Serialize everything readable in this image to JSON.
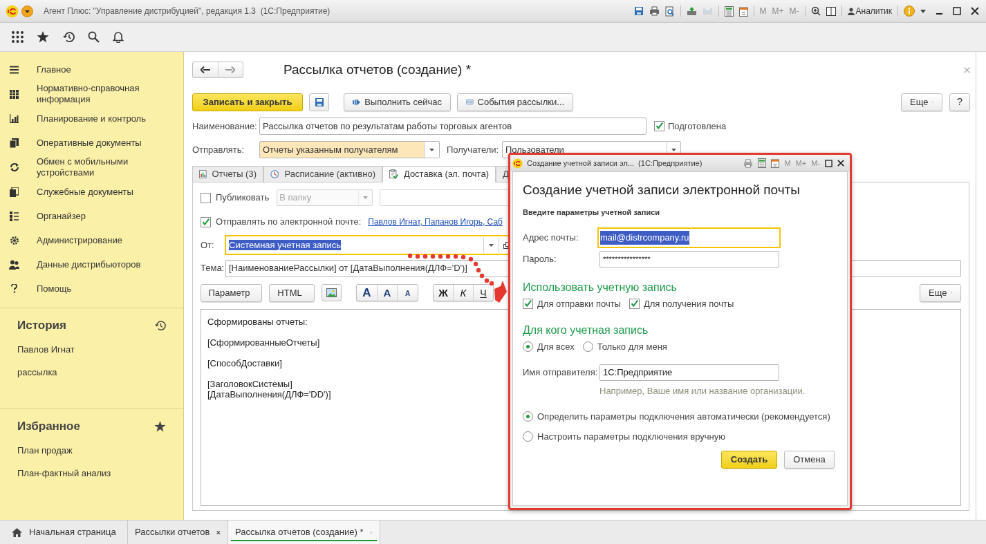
{
  "window": {
    "title": "Агент Плюс: \"Управление дистрибуцией\", редакция 1.3  (1С:Предприятие)",
    "memory_buttons": [
      "M",
      "M+",
      "M-"
    ],
    "user": "Аналитик"
  },
  "sidebar": {
    "items": [
      {
        "label": "Главное"
      },
      {
        "label": "Нормативно-справочная информация"
      },
      {
        "label": "Планирование и контроль"
      },
      {
        "label": "Оперативные документы"
      },
      {
        "label": "Обмен с мобильными устройствами"
      },
      {
        "label": "Служебные документы"
      },
      {
        "label": "Органайзер"
      },
      {
        "label": "Администрирование"
      },
      {
        "label": "Данные дистрибьюторов"
      },
      {
        "label": "Помощь"
      }
    ],
    "history": {
      "title": "История",
      "items": [
        {
          "label": "Павлов Игнат"
        },
        {
          "label": "рассылка"
        }
      ]
    },
    "favorites": {
      "title": "Избранное",
      "items": [
        {
          "label": "План продаж"
        },
        {
          "label": "План-фактный анализ"
        }
      ]
    }
  },
  "form": {
    "title": "Рассылка отчетов (создание) *",
    "buttons": {
      "save_close": "Записать и закрыть",
      "run_now": "Выполнить сейчас",
      "events": "События рассылки...",
      "more": "Еще",
      "help": "?"
    },
    "name": {
      "label": "Наименование:",
      "value": "Рассылка отчетов по результатам работы торговых агентов"
    },
    "prepared": {
      "label": "Подготовлена",
      "checked": true
    },
    "send": {
      "label": "Отправлять:",
      "value": "Отчеты указанным получателям"
    },
    "recipients": {
      "label": "Получатели:",
      "value": "Пользователи"
    },
    "tabs": [
      {
        "label": "Отчеты (3)",
        "selected": false
      },
      {
        "label": "Расписание (активно)",
        "selected": false
      },
      {
        "label": "Доставка (эл. почта)",
        "selected": true
      },
      {
        "label": "Д",
        "selected": false
      }
    ],
    "delivery": {
      "publish": {
        "label": "Публиковать",
        "checked": false
      },
      "folder": {
        "value": "В папку",
        "disabled": true
      },
      "email": {
        "label": "Отправлять по электронной почте:",
        "checked": true,
        "recipients_link": "Павлов Игнат, Папанов Игорь, Саб"
      },
      "from": {
        "label": "От:",
        "value": "Системная учетная запись",
        "highlighted": true
      },
      "subject": {
        "label": "Тема:",
        "value": "[НаименованиеРассылки] от [ДатаВыполнения(ДЛФ='D')]"
      },
      "toolbar": {
        "parameter": "Параметр",
        "html": "HTML",
        "font_buttons": [
          "A",
          "A",
          "A"
        ],
        "style_buttons": [
          "Ж",
          "К",
          "Ч"
        ],
        "more": "Еще"
      },
      "message": [
        "Сформированы отчеты:",
        "[СформированныеОтчеты]",
        "[СпособДоставки]",
        "[ЗаголовокСистемы]\n[ДатаВыполнения(ДЛФ='DD')]"
      ]
    }
  },
  "dialog": {
    "title": "Создание учетной записи эл...  (1С:Предприятие)",
    "memory_buttons": [
      "M",
      "M+",
      "M-"
    ],
    "heading": "Создание учетной записи электронной почты",
    "subheading": "Введите параметры учетной записи",
    "address": {
      "label": "Адрес почты:",
      "value": "mail@distrcompany.ru",
      "highlighted": true
    },
    "password": {
      "label": "Пароль:",
      "value": "****************"
    },
    "usage": {
      "title": "Использовать учетную запись",
      "options": [
        {
          "label": "Для отправки почты",
          "checked": true
        },
        {
          "label": "Для получения почты",
          "checked": true
        }
      ]
    },
    "audience": {
      "title": "Для кого учетная запись",
      "options": [
        {
          "label": "Для всех",
          "selected": true
        },
        {
          "label": "Только для меня",
          "selected": false
        }
      ]
    },
    "sender": {
      "label": "Имя отправителя:",
      "value": "1С:Предприятие",
      "hint": "Например, Ваше имя или название организации."
    },
    "connection": {
      "options": [
        {
          "label": "Определить параметры подключения автоматически (рекомендуется)",
          "selected": true
        },
        {
          "label": "Настроить параметры подключения вручную",
          "selected": false
        }
      ]
    },
    "buttons": {
      "create": "Создать",
      "cancel": "Отмена"
    }
  },
  "open_windows": [
    {
      "label": "Начальная страница",
      "selected": false,
      "closable": false
    },
    {
      "label": "Рассылки отчетов",
      "selected": false,
      "closable": true
    },
    {
      "label": "Рассылка отчетов (создание) *",
      "selected": true,
      "closable": true
    }
  ]
}
